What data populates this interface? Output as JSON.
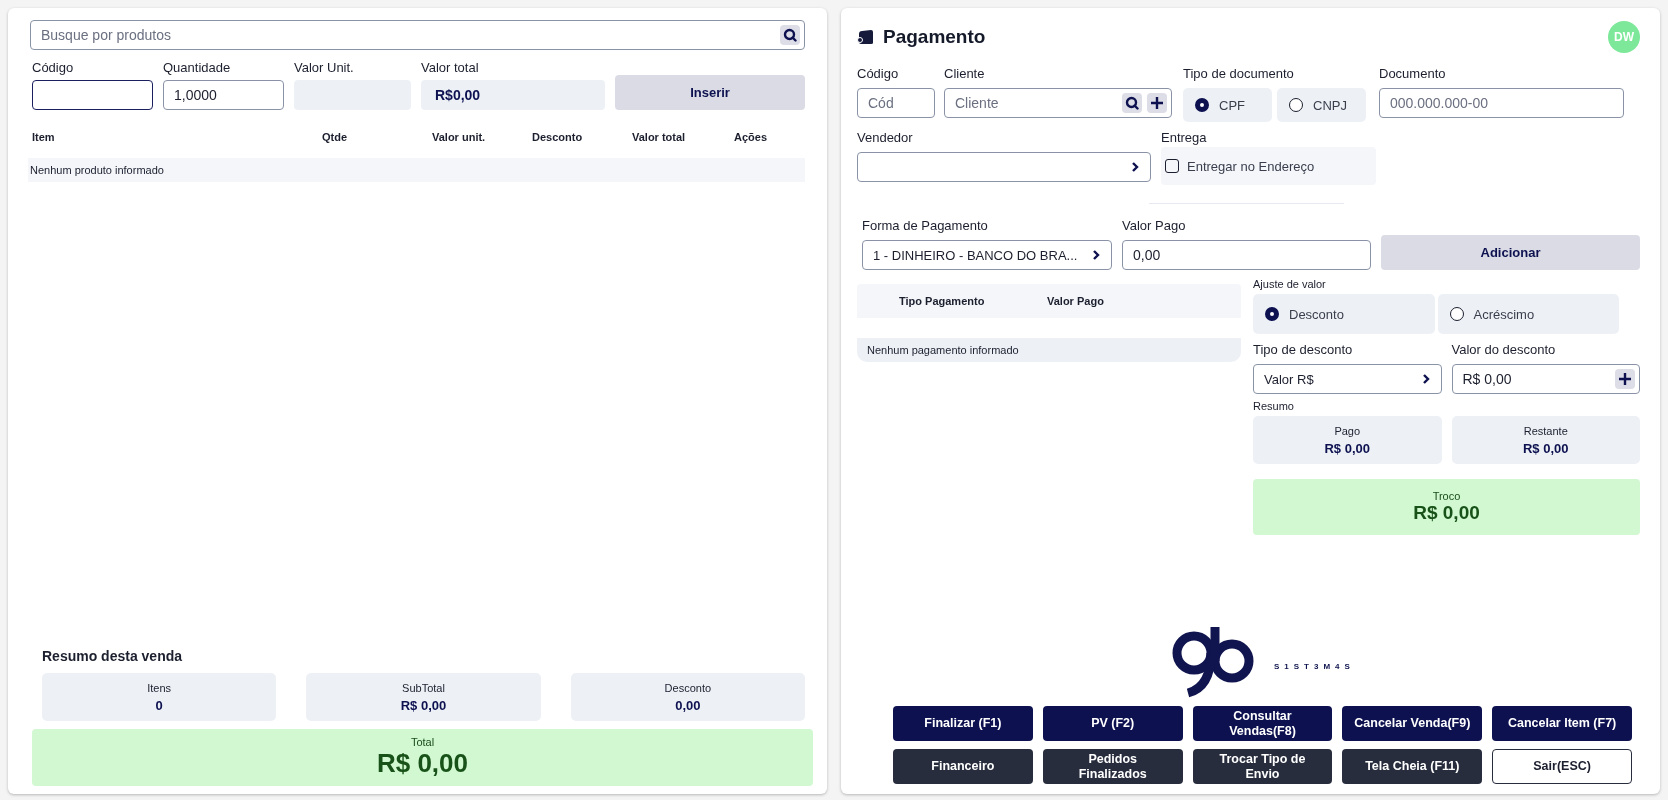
{
  "product_search": {
    "placeholder": "Busque por produtos"
  },
  "entry": {
    "fields": [
      {
        "label": "Código",
        "kind": "input",
        "focused": true
      },
      {
        "label": "Quantidade",
        "kind": "input",
        "value": "1,0000",
        "focused": false
      },
      {
        "label": "Valor Unit.",
        "kind": "readonly"
      },
      {
        "label": "Valor total",
        "kind": "readonly",
        "value": "R$0,00"
      }
    ],
    "button": "Inserir"
  },
  "items_table": {
    "columns": [
      "Item",
      "Qtde",
      "Valor unit.",
      "Desconto",
      "Valor total",
      "Ações"
    ],
    "empty_message": "Nenhum produto informado"
  },
  "sale_summary": {
    "title": "Resumo desta venda",
    "cards": [
      {
        "label": "Itens",
        "value": "0"
      },
      {
        "label": "SubTotal",
        "value": "R$ 0,00"
      },
      {
        "label": "Desconto",
        "value": "0,00"
      }
    ],
    "total": {
      "label": "Total",
      "value": "R$ 0,00"
    }
  },
  "payment": {
    "title": "Pagamento",
    "avatar": "DW",
    "codigo": {
      "label": "Código",
      "placeholder": "Cód"
    },
    "cliente": {
      "label": "Cliente",
      "placeholder": "Cliente"
    },
    "document_type": {
      "label": "Tipo de documento",
      "options": [
        {
          "label": "CPF",
          "selected": true
        },
        {
          "label": "CNPJ",
          "selected": false
        }
      ]
    },
    "documento": {
      "label": "Documento",
      "placeholder": "000.000.000-00"
    },
    "vendedor": {
      "label": "Vendedor"
    },
    "entrega": {
      "label": "Entrega",
      "option": "Entregar no Endereço",
      "checked": false
    },
    "forma_pagamento": {
      "label": "Forma de Pagamento",
      "value": "1 - DINHEIRO - BANCO DO BRA..."
    },
    "valor_pago": {
      "label": "Valor Pago",
      "value": "0,00"
    },
    "add_button": "Adicionar",
    "payments_table": {
      "columns": [
        "Tipo Pagamento",
        "Valor Pago"
      ],
      "empty_message": "Nenhum pagamento informado"
    },
    "ajuste": {
      "label": "Ajuste de valor",
      "options": [
        {
          "label": "Desconto",
          "selected": true
        },
        {
          "label": "Acréscimo",
          "selected": false
        }
      ]
    },
    "tipo_desconto": {
      "label": "Tipo de desconto",
      "value": "Valor R$"
    },
    "valor_desconto": {
      "label": "Valor do desconto",
      "value": "R$ 0,00"
    },
    "resumo": {
      "label": "Resumo",
      "cards": [
        {
          "label": "Pago",
          "value": "R$ 0,00"
        },
        {
          "label": "Restante",
          "value": "R$ 0,00"
        }
      ]
    },
    "troco": {
      "label": "Troco",
      "value": "R$ 0,00"
    }
  },
  "brand": {
    "tagline": "S1ST3M4S"
  },
  "actions": [
    {
      "label": "Finalizar (F1)",
      "kind": "primary"
    },
    {
      "label": "PV (F2)",
      "kind": "primary"
    },
    {
      "label": "Consultar Vendas(F8)",
      "kind": "primary"
    },
    {
      "label": "Cancelar Venda(F9)",
      "kind": "primary"
    },
    {
      "label": "Cancelar Item (F7)",
      "kind": "primary"
    },
    {
      "label": "Financeiro",
      "kind": "dark"
    },
    {
      "label": "Pedidos Finalizados",
      "kind": "dark"
    },
    {
      "label": "Trocar Tipo de Envio",
      "kind": "dark"
    },
    {
      "label": "Tela Cheia (F11)",
      "kind": "dark"
    },
    {
      "label": "Sair(ESC)",
      "kind": "outline"
    }
  ]
}
